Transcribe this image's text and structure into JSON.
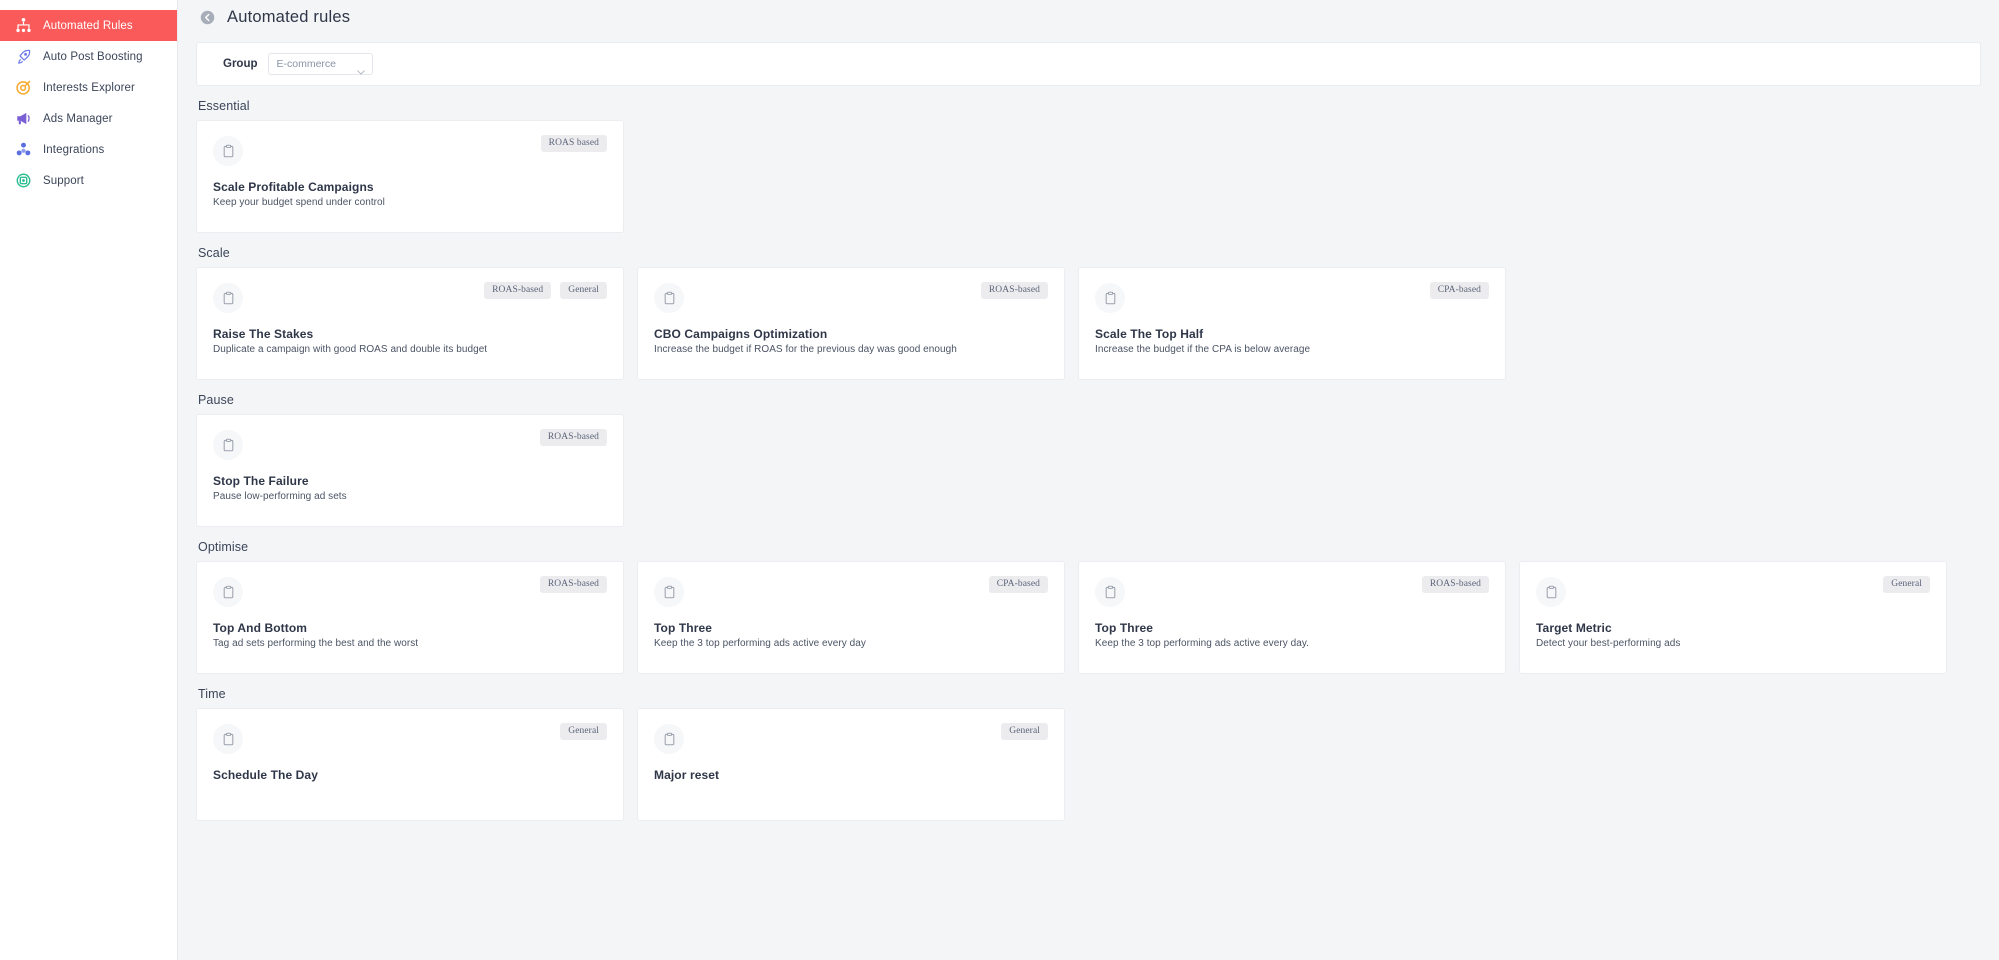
{
  "colors": {
    "accent": "#fb5a5a",
    "page_bg": "#f4f5f7",
    "card_bg": "#ffffff",
    "badge_bg": "#ececef",
    "text": "#2e3648"
  },
  "sidebar": {
    "items": [
      {
        "label": "Automated Rules",
        "icon": "sitemap-icon",
        "active": true
      },
      {
        "label": "Auto Post Boosting",
        "icon": "rocket-icon",
        "active": false
      },
      {
        "label": "Interests Explorer",
        "icon": "target-icon",
        "active": false
      },
      {
        "label": "Ads Manager",
        "icon": "megaphone-icon",
        "active": false
      },
      {
        "label": "Integrations",
        "icon": "cubes-icon",
        "active": false
      },
      {
        "label": "Support",
        "icon": "lifebuoy-icon",
        "active": false
      }
    ]
  },
  "header": {
    "back_icon": "back-arrow-icon",
    "title": "Automated rules"
  },
  "filter": {
    "label": "Group",
    "group_value": "E-commerce",
    "group_placeholder": "E-commerce",
    "chevron_icon": "chevron-down-icon"
  },
  "sections": [
    {
      "title": "Essential",
      "cards": [
        {
          "icon": "clipboard-icon",
          "title": "Scale Profitable Campaigns",
          "desc": "Keep your budget spend under control",
          "badges": [
            "ROAS based"
          ]
        }
      ]
    },
    {
      "title": "Scale",
      "cards": [
        {
          "icon": "clipboard-icon",
          "title": "Raise The Stakes",
          "desc": "Duplicate a campaign with good ROAS and double its budget",
          "badges": [
            "ROAS-based",
            "General"
          ]
        },
        {
          "icon": "clipboard-icon",
          "title": "CBO Campaigns Optimization",
          "desc": "Increase the budget if ROAS for the previous day was good enough",
          "badges": [
            "ROAS-based"
          ]
        },
        {
          "icon": "clipboard-icon",
          "title": "Scale The Top Half",
          "desc": "Increase the budget if the CPA is below average",
          "badges": [
            "CPA-based"
          ]
        }
      ]
    },
    {
      "title": "Pause",
      "cards": [
        {
          "icon": "clipboard-icon",
          "title": "Stop The Failure",
          "desc": "Pause low-performing ad sets",
          "badges": [
            "ROAS-based"
          ]
        }
      ]
    },
    {
      "title": "Optimise",
      "cards": [
        {
          "icon": "clipboard-icon",
          "title": "Top And Bottom",
          "desc": "Tag ad sets performing the best and the worst",
          "badges": [
            "ROAS-based"
          ]
        },
        {
          "icon": "clipboard-icon",
          "title": "Top Three",
          "desc": "Keep the 3 top performing ads active every day",
          "badges": [
            "CPA-based"
          ]
        },
        {
          "icon": "clipboard-icon",
          "title": "Top Three",
          "desc": "Keep the 3 top performing ads active every day.",
          "badges": [
            "ROAS-based"
          ]
        },
        {
          "icon": "clipboard-icon",
          "title": "Target Metric",
          "desc": "Detect your best-performing ads",
          "badges": [
            "General"
          ]
        }
      ]
    },
    {
      "title": "Time",
      "cards": [
        {
          "icon": "clipboard-icon",
          "title": "Schedule The Day",
          "desc": "",
          "badges": [
            "General"
          ]
        },
        {
          "icon": "clipboard-icon",
          "title": "Major reset",
          "desc": "",
          "badges": [
            "General"
          ]
        }
      ]
    }
  ]
}
